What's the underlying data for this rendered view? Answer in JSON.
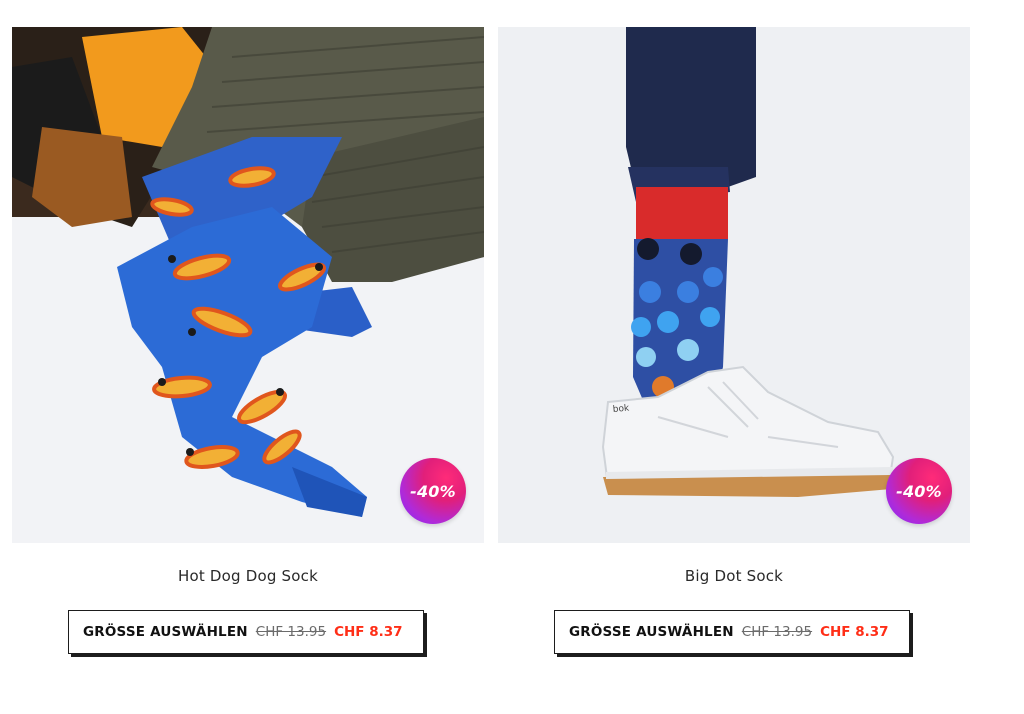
{
  "products": [
    {
      "name": "Hot Dog Dog Sock",
      "discount_badge": "-40%",
      "button": {
        "size_label": "GRÖSSE AUSWÄHLEN",
        "old_price": "CHF 13.95",
        "new_price": "CHF 8.37"
      },
      "image_icon": "hot-dog-sock-photo"
    },
    {
      "name": "Big Dot Sock",
      "discount_badge": "-40%",
      "button": {
        "size_label": "GRÖSSE AUSWÄHLEN",
        "old_price": "CHF 13.95",
        "new_price": "CHF 8.37"
      },
      "image_icon": "big-dot-sock-photo"
    }
  ],
  "colors": {
    "sale_price": "#ff2e17",
    "badge_gradient_start": "#ff2b79",
    "badge_gradient_end": "#7d2cff",
    "button_border": "#1d1d1d"
  }
}
